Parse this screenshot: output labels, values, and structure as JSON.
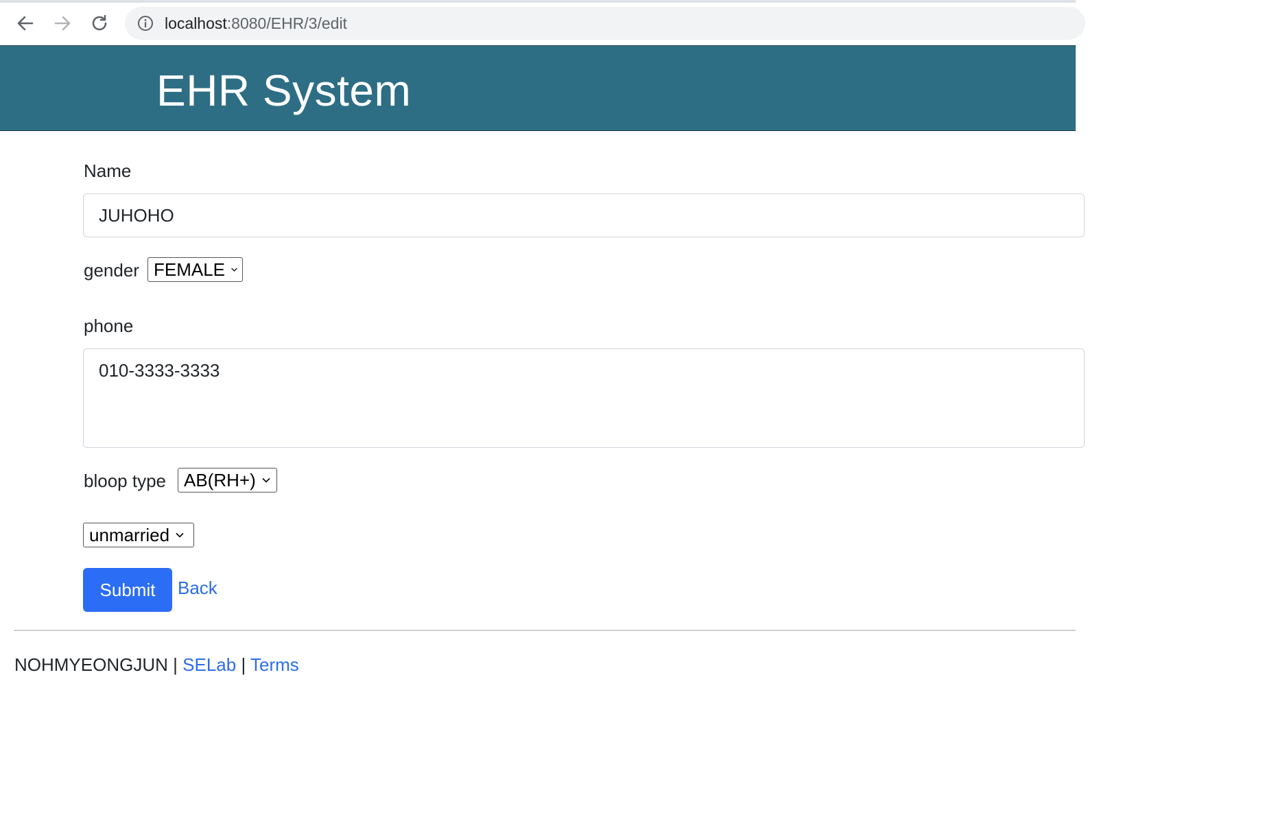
{
  "browser": {
    "url_host": "localhost",
    "url_rest": ":8080/EHR/3/edit",
    "icons": [
      "back-arrow-icon",
      "forward-arrow-icon",
      "reload-icon",
      "info-icon"
    ]
  },
  "header": {
    "title": "EHR System",
    "background_color": "#2e6e84"
  },
  "form": {
    "name_label": "Name",
    "name_value": "JUHOHO",
    "gender_label": "gender",
    "gender_value": "FEMALE",
    "phone_label": "phone",
    "phone_value": "010-3333-3333",
    "blood_label": "bloop type",
    "blood_value": "AB(RH+)",
    "marital_value": "unmarried",
    "submit_label": "Submit",
    "back_label": "Back"
  },
  "footer": {
    "author": "NOHMYEONGJUN",
    "separator": "|",
    "link1": "SELab",
    "link2": "Terms"
  },
  "colors": {
    "primary_button": "#2c6df5",
    "link": "#2c6de8"
  }
}
